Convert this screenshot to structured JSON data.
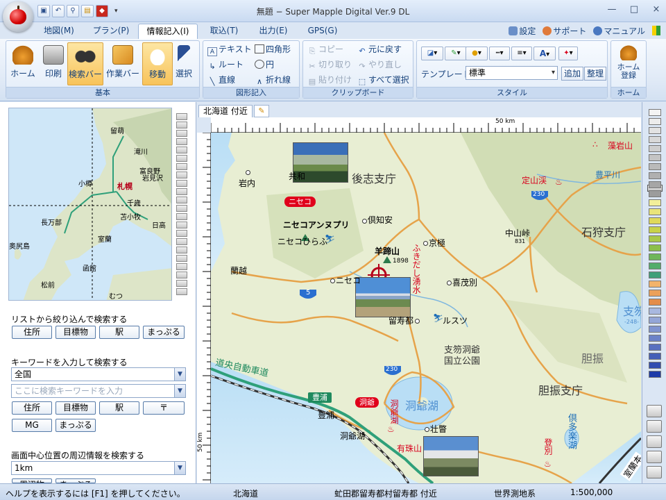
{
  "window": {
    "title": "無題 − Super Mapple Digital Ver.9 DL",
    "minimize": "—",
    "maximize": "□",
    "close": "×"
  },
  "quick_access": [
    "save-icon",
    "undo-icon",
    "search-icon",
    "folder-icon",
    "mark-icon"
  ],
  "menu": {
    "tabs": [
      "地図(M)",
      "プラン(P)",
      "情報記入(I)",
      "取込(T)",
      "出力(E)",
      "GPS(G)"
    ],
    "active_tab": "情報記入(I)",
    "settings": "設定",
    "support": "サポート",
    "manual": "マニュアル"
  },
  "ribbon": {
    "basic": {
      "label": "基本",
      "home": "ホーム",
      "print": "印刷",
      "search_bar": "検索バー",
      "work_bar": "作業バー",
      "move": "移動",
      "select": "選択"
    },
    "shapes": {
      "label": "図形記入",
      "text": "テキスト",
      "rectangle": "四角形",
      "route": "ルート",
      "circle": "円",
      "line": "直線",
      "polyline": "折れ線"
    },
    "clipboard": {
      "label": "クリップボード",
      "copy": "コピー",
      "undo": "元に戻す",
      "cut": "切り取り",
      "redo": "やり直し",
      "paste": "貼り付け",
      "select_all": "すべて選択"
    },
    "style": {
      "label": "スタイル",
      "template_label": "テンプレート",
      "template_value": "標準",
      "add": "追加",
      "organize": "整理",
      "font_color_letter": "A"
    },
    "home_group": {
      "label": "ホーム",
      "register": "ホーム\n登録"
    }
  },
  "left_panel": {
    "minimap_labels": [
      "留萌",
      "滝川",
      "小樽",
      "札幌",
      "富良野",
      "岩見沢",
      "千歳",
      "苫小牧",
      "長万部",
      "日高",
      "室蘭",
      "奥尻島",
      "函館",
      "松前",
      "むつ"
    ],
    "list_search_title": "リストから絞り込んで検索する",
    "list_buttons": [
      "住所",
      "目標物",
      "駅",
      "まっぷる"
    ],
    "keyword_title": "キーワードを入力して検索する",
    "area_select": "全国",
    "keyword_placeholder": "ここに検索キーワードを入力",
    "keyword_buttons": [
      "住所",
      "目標物",
      "駅",
      "〒"
    ],
    "keyword_buttons2": [
      "MG",
      "まっぷる"
    ],
    "nearby_title": "画面中心位置の周辺情報を検索する",
    "radius_select": "1km",
    "more_buttons": [
      "周辺物",
      "まっぷる"
    ]
  },
  "map": {
    "tab_label": "北海道 付近",
    "scale_top": "50 km",
    "scale_left": "50 km",
    "labels": {
      "shiribeshi": "後志支庁",
      "iwanai": "岩内",
      "kyowa": "共和",
      "niseko_badge": "ニセコ",
      "niseko_annupuri": "ニセコアンヌプリ",
      "niseko_hirafu": "ニセコひらふ",
      "kutchan": "倶知安",
      "kyogoku": "京極",
      "yotei": "羊蹄山",
      "yotei_alt": "1898",
      "fukidashi": "ふきだし湧水",
      "rankoshi": "蘭越",
      "niseko_town": "ニセコ",
      "kimobetsu": "喜茂別",
      "rusutsu": "留寿都",
      "rusutsu_ski": "ルスツ",
      "shikotsu_toya": "支笏洞爺\n国立公園",
      "doou": "道央自動車道",
      "toyoura_badge": "豊浦",
      "toyoura": "豊浦",
      "toya_badge": "洞爺",
      "toya_lake": "洞爺湖",
      "toya_onsen": "洞爺湖",
      "toyako_town": "洞爺湖",
      "sobetsu": "壮瞥",
      "usuzan": "有珠山",
      "noboribetsu": "登別",
      "kuttara": "倶多楽湖",
      "iburi": "胆振",
      "iburi_shicho": "胆振支庁",
      "ishikari": "石狩支庁",
      "jozankei": "定山渓",
      "nakayama": "中山峠",
      "nakayama_alt": "831",
      "moiwa": "藻岩山",
      "toyohira": "豊平川",
      "shikotsu": "支笏",
      "shikotsu_alt": "-248-",
      "muroran_exp": "室蘭本",
      "route5": "5",
      "route230a": "230",
      "route230b": "230"
    }
  },
  "status": {
    "help": "ヘルプを表示するには [F1] を押してください。",
    "region": "北海道",
    "address": "虻田郡留寿都村留寿都 付近",
    "datum": "世界測地系",
    "scale": "1:500,000"
  }
}
